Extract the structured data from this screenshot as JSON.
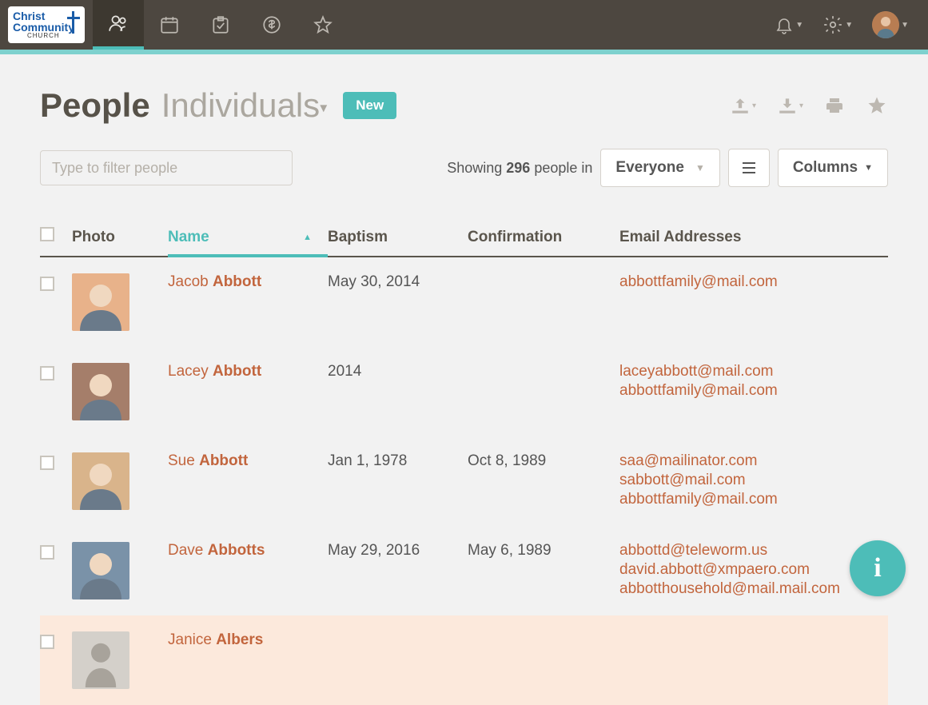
{
  "logo": {
    "line1": "Christ",
    "line2": "Community",
    "line3": "CHURCH"
  },
  "page": {
    "title": "People",
    "subtitle": "Individuals",
    "new_label": "New"
  },
  "filter": {
    "placeholder": "Type to filter people",
    "showing_prefix": "Showing ",
    "count": "296",
    "showing_suffix": " people in",
    "group": "Everyone",
    "columns_label": "Columns"
  },
  "columns": {
    "photo": "Photo",
    "name": "Name",
    "baptism": "Baptism",
    "confirmation": "Confirmation",
    "email": "Email Addresses"
  },
  "rows": [
    {
      "first": "Jacob",
      "last": "Abbott",
      "baptism": "May 30, 2014",
      "confirmation": "",
      "emails": [
        "abbottfamily@mail.com"
      ],
      "photo_bg": "#e8b28a"
    },
    {
      "first": "Lacey",
      "last": "Abbott",
      "baptism": "2014",
      "confirmation": "",
      "emails": [
        "laceyabbott@mail.com",
        "abbottfamily@mail.com"
      ],
      "photo_bg": "#a57e6a"
    },
    {
      "first": "Sue",
      "last": "Abbott",
      "baptism": "Jan 1, 1978",
      "confirmation": "Oct 8, 1989",
      "emails": [
        "saa@mailinator.com",
        "sabbott@mail.com",
        "abbottfamily@mail.com"
      ],
      "photo_bg": "#d9b48b"
    },
    {
      "first": "Dave",
      "last": "Abbotts",
      "baptism": "May 29, 2016",
      "confirmation": "May 6, 1989",
      "emails": [
        "abbottd@teleworm.us",
        "david.abbott@xmpaero.com",
        "abbotthousehold@mail.mail.com"
      ],
      "photo_bg": "#7a92a8"
    },
    {
      "first": "Janice",
      "last": "Albers",
      "baptism": "",
      "confirmation": "",
      "emails": [],
      "placeholder": true
    }
  ]
}
